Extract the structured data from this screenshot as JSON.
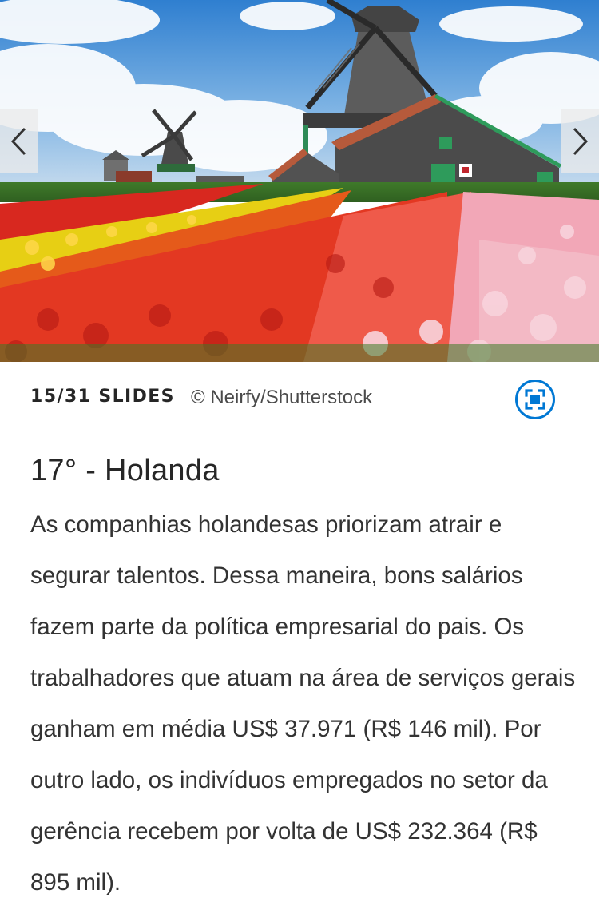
{
  "slideshow": {
    "counter": "15/31 SLIDES",
    "credit": "© Neirfy/Shutterstock",
    "image_icon": "windmill-tulip-field-photo",
    "prev_icon": "chevron-left-icon",
    "next_icon": "chevron-right-icon",
    "fullscreen_icon": "fullscreen-icon"
  },
  "article": {
    "title": "17° - Holanda",
    "body": "As companhias holandesas priorizam atrair e segurar talentos. Dessa maneira, bons salários fazem parte da política empresarial do pais. Os trabalhadores que atuam na área de serviços gerais ganham em média US$ 37.971 (R$ 146 mil). Por outro lado, os indivíduos empregados no setor da gerência recebem por volta de US$ 232.364 (R$ 895 mil)."
  },
  "colors": {
    "accent": "#0078d4",
    "text": "#262626"
  }
}
